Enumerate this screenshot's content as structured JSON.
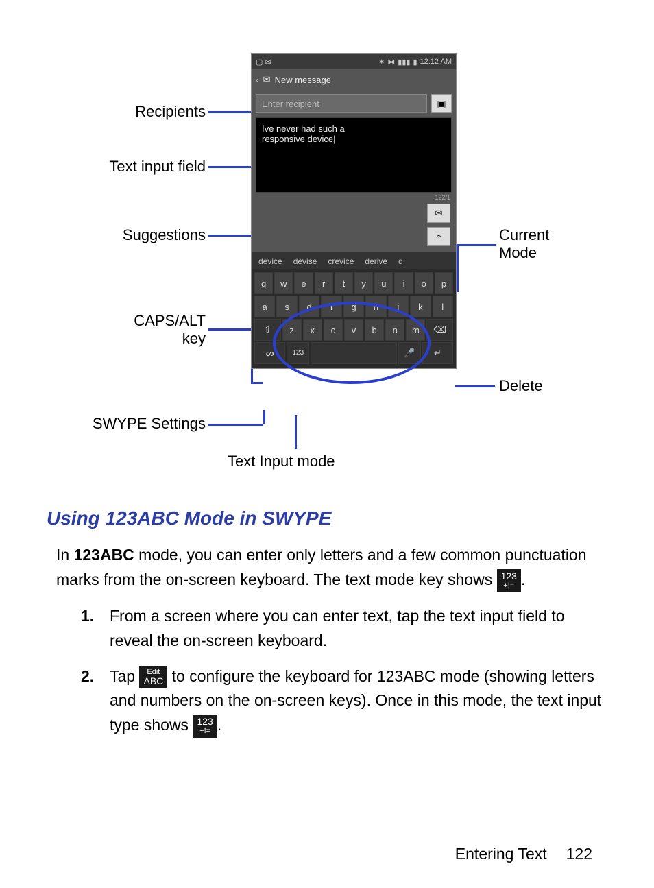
{
  "diagram": {
    "callouts": {
      "recipients": "Recipients",
      "text_input_field": "Text input field",
      "suggestions": "Suggestions",
      "caps_alt": "CAPS/ALT\nkey",
      "swype_settings": "SWYPE Settings",
      "text_input_mode": "Text Input mode",
      "current_mode": "Current\nMode",
      "delete": "Delete"
    },
    "phone": {
      "time": "12:12 AM",
      "title": "New message",
      "recipient_placeholder": "Enter recipient",
      "message_line1": "Ive never had such a",
      "message_line2_pre": "responsive ",
      "message_line2_u": "device",
      "counter": "122/1",
      "suggestions": [
        "device",
        "devise",
        "crevice",
        "derive",
        "d"
      ],
      "rows": {
        "r1": [
          "q",
          "w",
          "e",
          "r",
          "t",
          "y",
          "u",
          "i",
          "o",
          "p"
        ],
        "r2": [
          "a",
          "s",
          "d",
          "f",
          "g",
          "h",
          "j",
          "k",
          "l"
        ],
        "r3_mid": [
          "z",
          "x",
          "c",
          "v",
          "b",
          "n",
          "m"
        ],
        "mode_label": "123"
      }
    }
  },
  "heading": "Using 123ABC Mode in SWYPE",
  "para": {
    "pre": "In ",
    "bold": "123ABC",
    "post": " mode, you can enter only letters and a few common punctuation marks from the on-screen keyboard. The text mode key shows ",
    "key_top": "123",
    "key_bot": "+!=",
    "end": "."
  },
  "steps": {
    "s1_num": "1.",
    "s1": "From a screen where you can enter text, tap the text input field to reveal the on-screen keyboard.",
    "s2_num": "2.",
    "s2_pre": "Tap ",
    "s2_key_top": "Edit",
    "s2_key_bot": "ABC",
    "s2_mid": " to configure the keyboard for 123ABC mode (showing letters and numbers on the on-screen keys). Once in this mode, the text input type shows ",
    "s2_key2_top": "123",
    "s2_key2_bot": "+!=",
    "s2_end": "."
  },
  "footer": {
    "section": "Entering Text",
    "page": "122"
  }
}
